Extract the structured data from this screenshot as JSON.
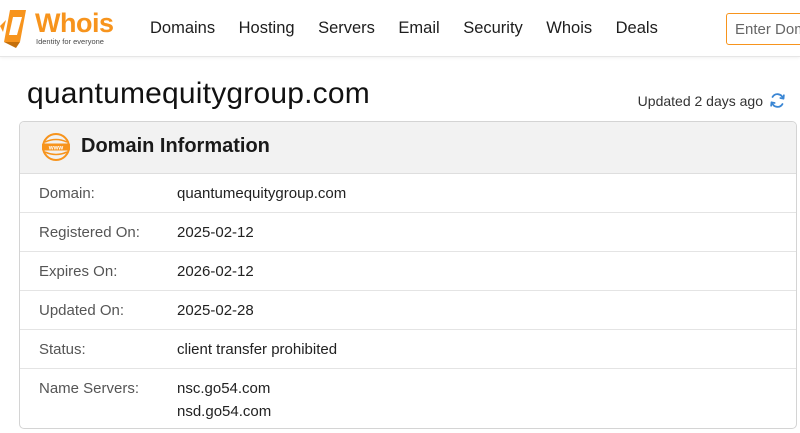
{
  "brand": {
    "name": "Whois",
    "tagline": "Identity for everyone",
    "accent": "#f7941d"
  },
  "nav": {
    "items": [
      {
        "label": "Domains"
      },
      {
        "label": "Hosting"
      },
      {
        "label": "Servers"
      },
      {
        "label": "Email"
      },
      {
        "label": "Security"
      },
      {
        "label": "Whois"
      },
      {
        "label": "Deals"
      }
    ]
  },
  "search": {
    "placeholder": "Enter Domain or IP",
    "value": ""
  },
  "page": {
    "title": "quantumequitygroup.com",
    "updated": "Updated 2 days ago",
    "refresh_icon": "refresh-icon"
  },
  "card": {
    "title": "Domain Information",
    "icon": "www-icon",
    "rows": [
      {
        "label": "Domain:",
        "value": "quantumequitygroup.com"
      },
      {
        "label": "Registered On:",
        "value": "2025-02-12"
      },
      {
        "label": "Expires On:",
        "value": "2026-02-12"
      },
      {
        "label": "Updated On:",
        "value": "2025-02-28"
      },
      {
        "label": "Status:",
        "value": "client transfer prohibited"
      }
    ],
    "name_servers": {
      "label": "Name Servers:",
      "values": [
        "nsc.go54.com",
        "nsd.go54.com"
      ]
    }
  }
}
